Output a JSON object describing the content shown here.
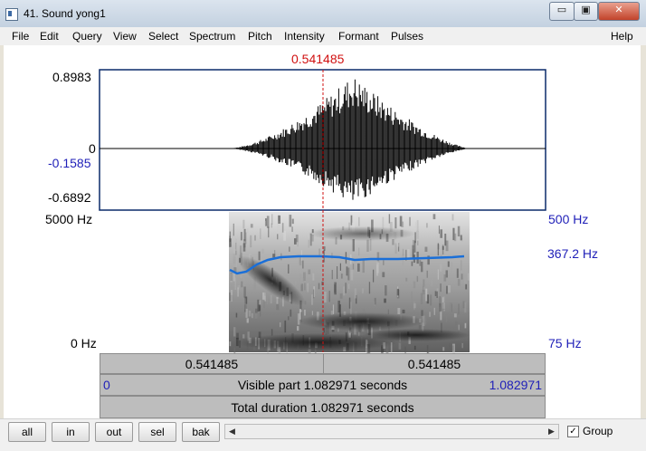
{
  "window": {
    "title": "41. Sound yong1",
    "minimize_glyph": "▭",
    "maximize_glyph": "▣",
    "close_glyph": "✕"
  },
  "menu": {
    "items": [
      "File",
      "Edit",
      "Query",
      "View",
      "Select",
      "Spectrum",
      "Pitch",
      "Intensity",
      "Formant",
      "Pulses"
    ],
    "help": "Help"
  },
  "cursor": {
    "time_label": "0.541485"
  },
  "waveform": {
    "y_max": "0.8983",
    "y_zero": "0",
    "y_cursor_value": "-0.1585",
    "y_min": "-0.6892"
  },
  "spectrogram": {
    "freq_max": "5000 Hz",
    "freq_min": "0 Hz",
    "pitch_max": "500 Hz",
    "pitch_cursor_value": "367.2 Hz",
    "pitch_min": "75 Hz"
  },
  "bars": {
    "left_interval": "0.541485",
    "right_interval": "0.541485",
    "visible_start": "0",
    "visible_text": "Visible part 1.082971 seconds",
    "visible_end": "1.082971",
    "total_text": "Total duration 1.082971 seconds"
  },
  "toolbar": {
    "buttons": [
      "all",
      "in",
      "out",
      "sel",
      "bak"
    ],
    "scroll_left": "◀",
    "scroll_right": "▶",
    "group_label": "Group",
    "group_checked_glyph": "✓"
  },
  "colors": {
    "cursor": "#d01010",
    "pitch": "#1a6fd8",
    "axis_blue": "#1f1fb8",
    "frame": "#0a2a6a"
  }
}
